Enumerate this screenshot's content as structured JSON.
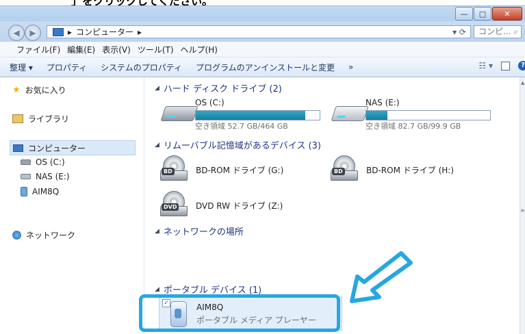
{
  "top_fragment": "」をクリックしてください。",
  "window": {
    "buttons": {
      "minimize": "—",
      "maximize": "□",
      "close": "✕"
    }
  },
  "address": {
    "path_sep": "▸",
    "location": "コンピューター",
    "trail": "▸",
    "search_placeholder": "コンピ..."
  },
  "menubar": {
    "items": [
      "ファイル(F)",
      "編集(E)",
      "表示(V)",
      "ツール(T)",
      "ヘルプ(H)"
    ]
  },
  "toolbar": {
    "organize": "整理 ▾",
    "properties": "プロパティ",
    "system_properties": "システムのプロパティ",
    "uninstall": "プログラムのアンインストールと変更",
    "more": "»"
  },
  "nav": {
    "favorites": "お気に入り",
    "libraries": "ライブラリ",
    "computer": "コンピューター",
    "drive_c": "OS (C:)",
    "drive_e": "NAS (E:)",
    "device": "AIM8Q",
    "network": "ネットワーク"
  },
  "groups": {
    "hdd": "ハード ディスク ドライブ (2)",
    "removable": "リムーバブル記憶域があるデバイス (3)",
    "network_locations": "ネットワークの場所",
    "portable": "ポータブル デバイス (1)"
  },
  "hdd": [
    {
      "label": "OS (C:)",
      "free": "空き領域 52.7 GB/464 GB",
      "used_fraction": 0.886
    },
    {
      "label": "NAS (E:)",
      "free": "空き領域 82.7 GB/99.9 GB",
      "used_fraction": 0.172
    }
  ],
  "removable": [
    {
      "label": "BD-ROM ドライブ (G:)",
      "tag": "BD"
    },
    {
      "label": "BD-ROM ドライブ (H:)",
      "tag": "BD"
    },
    {
      "label": "DVD RW ドライブ (Z:)",
      "tag": "DVD"
    }
  ],
  "portable_device": {
    "name": "AIM8Q",
    "type": "ポータブル メディア プレーヤー"
  },
  "colors": {
    "highlight": "#27a6e3",
    "group_heading": "#1e3287"
  }
}
